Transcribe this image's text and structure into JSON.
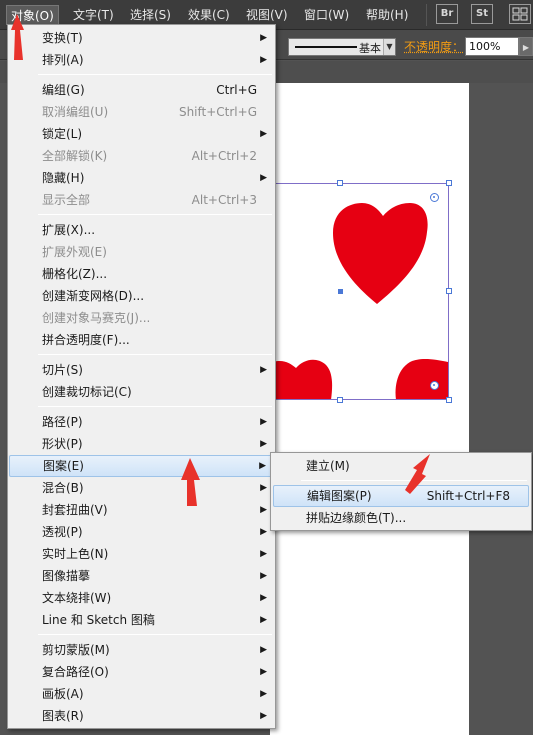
{
  "menubar": {
    "items": [
      {
        "label": "对象(O)",
        "active": true
      },
      {
        "label": "文字(T)"
      },
      {
        "label": "选择(S)"
      },
      {
        "label": "效果(C)"
      },
      {
        "label": "视图(V)"
      },
      {
        "label": "窗口(W)"
      },
      {
        "label": "帮助(H)"
      }
    ],
    "app_icons": [
      "Br",
      "St"
    ]
  },
  "controlbar": {
    "stroke_style_label": "基本",
    "opacity_label": "不透明度：",
    "opacity_value": "100%"
  },
  "object_menu": {
    "items": [
      {
        "label": "变换(T)",
        "submenu": true
      },
      {
        "label": "排列(A)",
        "submenu": true
      },
      {
        "label": "编组(G)",
        "shortcut": "Ctrl+G"
      },
      {
        "label": "取消编组(U)",
        "shortcut": "Shift+Ctrl+G",
        "disabled": true
      },
      {
        "label": "锁定(L)",
        "submenu": true
      },
      {
        "label": "全部解锁(K)",
        "shortcut": "Alt+Ctrl+2",
        "disabled": true
      },
      {
        "label": "隐藏(H)",
        "submenu": true
      },
      {
        "label": "显示全部",
        "shortcut": "Alt+Ctrl+3",
        "disabled": true
      },
      {
        "label": "扩展(X)..."
      },
      {
        "label": "扩展外观(E)",
        "disabled": true
      },
      {
        "label": "栅格化(Z)..."
      },
      {
        "label": "创建渐变网格(D)..."
      },
      {
        "label": "创建对象马赛克(J)...",
        "disabled": true
      },
      {
        "label": "拼合透明度(F)..."
      },
      {
        "label": "切片(S)",
        "submenu": true
      },
      {
        "label": "创建裁切标记(C)"
      },
      {
        "label": "路径(P)",
        "submenu": true
      },
      {
        "label": "形状(P)",
        "submenu": true
      },
      {
        "label": "图案(E)",
        "submenu": true,
        "highlighted": true
      },
      {
        "label": "混合(B)",
        "submenu": true
      },
      {
        "label": "封套扭曲(V)",
        "submenu": true
      },
      {
        "label": "透视(P)",
        "submenu": true
      },
      {
        "label": "实时上色(N)",
        "submenu": true
      },
      {
        "label": "图像描摹",
        "submenu": true
      },
      {
        "label": "文本绕排(W)",
        "submenu": true
      },
      {
        "label": "Line 和 Sketch 图稿",
        "submenu": true
      },
      {
        "label": "剪切蒙版(M)",
        "submenu": true
      },
      {
        "label": "复合路径(O)",
        "submenu": true
      },
      {
        "label": "画板(A)",
        "submenu": true
      },
      {
        "label": "图表(R)",
        "submenu": true
      }
    ]
  },
  "pattern_submenu": {
    "items": [
      {
        "label": "建立(M)"
      },
      {
        "label": "编辑图案(P)",
        "shortcut": "Shift+Ctrl+F8",
        "highlighted": true
      },
      {
        "label": "拼贴边缘颜色(T)..."
      }
    ]
  },
  "colors": {
    "heart": "#e60012",
    "annotation_arrow": "#e8322b",
    "highlight": "#cfe3f8",
    "opacity_label": "#f39c12"
  }
}
